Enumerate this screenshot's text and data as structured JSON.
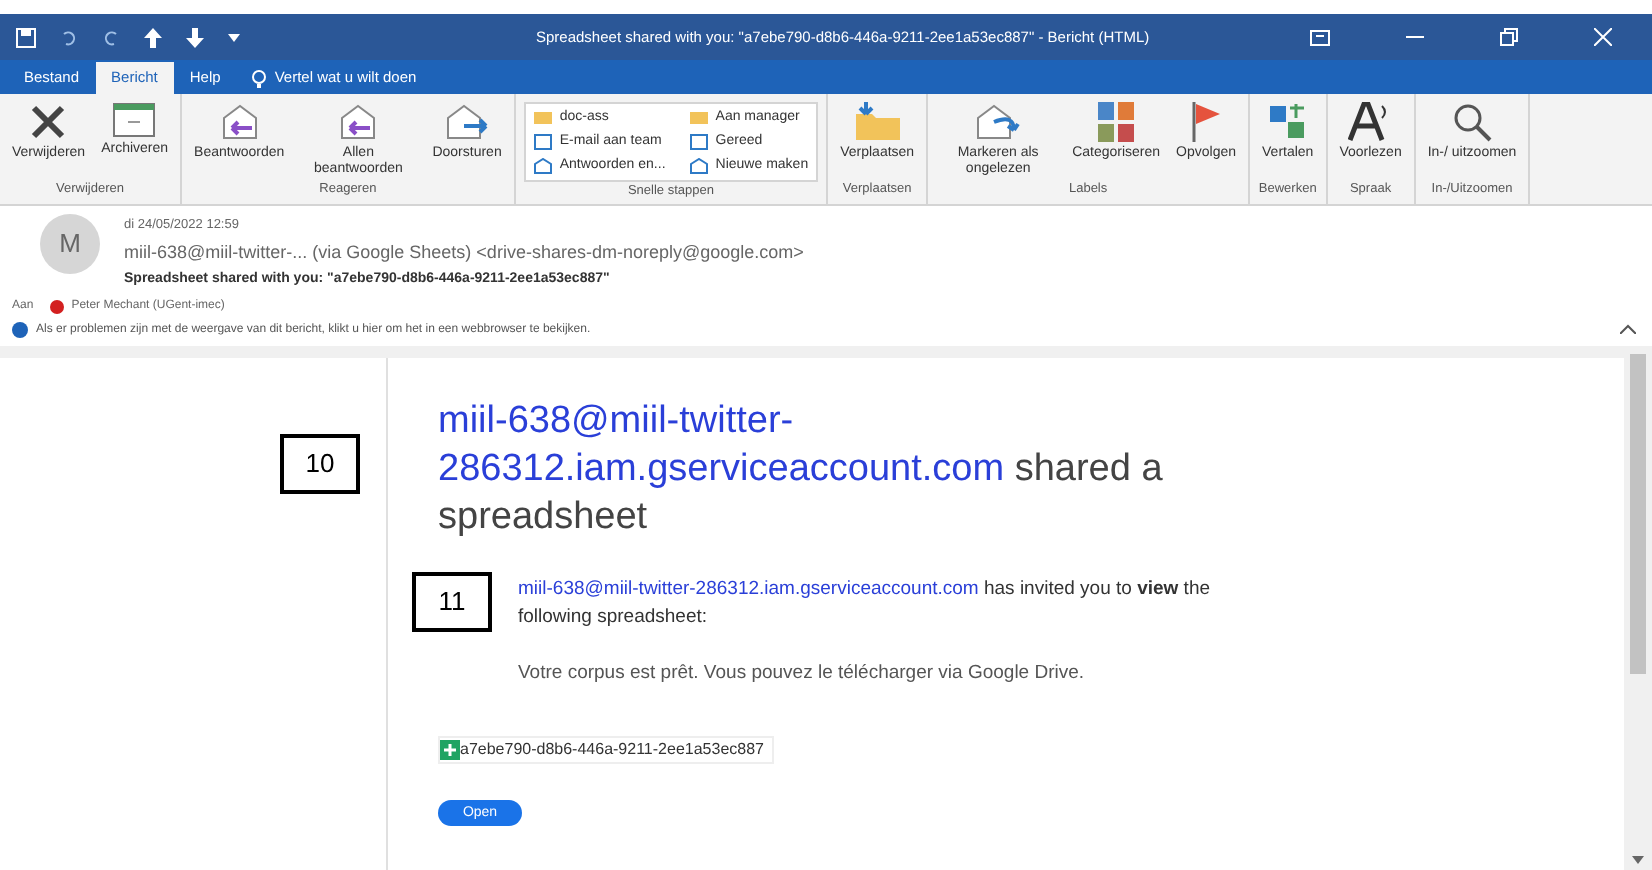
{
  "window": {
    "title": "Spreadsheet shared with you: \"a7ebe790-d8b6-446a-9211-2ee1a53ec887\"  -  Bericht (HTML)"
  },
  "tabs": [
    {
      "label": "Bestand",
      "selected": false
    },
    {
      "label": "Bericht",
      "selected": true
    },
    {
      "label": "Help",
      "selected": false
    }
  ],
  "tell_me": {
    "placeholder": "Vertel wat u wilt doen"
  },
  "ribbon": {
    "groups": [
      {
        "label": "Verwijderen",
        "buttons": [
          {
            "label": "Verwijderen"
          },
          {
            "label": "Archiveren"
          }
        ]
      },
      {
        "label": "Reageren",
        "buttons": [
          {
            "label": "Beantwoorden"
          },
          {
            "label": "Allen beantwoorden"
          },
          {
            "label": "Doorsturen"
          }
        ]
      },
      {
        "label": "Snelle stappen",
        "quick_steps": [
          "doc-ass",
          "E-mail aan team",
          "Antwoorden en...",
          "Aan manager",
          "Gereed",
          "Nieuwe maken"
        ]
      },
      {
        "label": "Verplaatsen",
        "buttons": [
          {
            "label": "Verplaatsen"
          }
        ]
      },
      {
        "label": "Labels",
        "buttons": [
          {
            "label": "Markeren als ongelezen"
          },
          {
            "label": "Categoriseren"
          },
          {
            "label": "Opvolgen"
          }
        ]
      },
      {
        "label": "Bewerken",
        "buttons": [
          {
            "label": "Vertalen"
          }
        ]
      },
      {
        "label": "Spraak",
        "buttons": [
          {
            "label": "Voorlezen"
          }
        ]
      },
      {
        "label": "In-/Uitzoomen",
        "buttons": [
          {
            "label": "In-/ uitzoomen"
          }
        ]
      }
    ]
  },
  "message": {
    "avatar": "M",
    "date": "di 24/05/2022 12:59",
    "from": "miil-638@miil-twitter-... (via Google Sheets) <drive-shares-dm-noreply@google.com>",
    "subject": "Spreadsheet shared with you: \"a7ebe790-d8b6-446a-9211-2ee1a53ec887\"",
    "to_label": "Aan",
    "to": "Peter Mechant (UGent-imec)",
    "info": "Als er problemen zijn met de weergave van dit bericht, klikt u hier om het in een webbrowser te bekijken."
  },
  "body": {
    "marker_1": "10",
    "heading_link": "miil-638@miil-twitter-286312.iam.gserviceaccount.com",
    "heading_rest": " shared a spreadsheet",
    "marker_2": "11",
    "invite_link": "miil-638@miil-twitter-286312.iam.gserviceaccount.com",
    "invite": " has invited you to **view** the following spreadsheet:",
    "note": "Votre corpus est prêt. Vous pouvez le télécharger via Google Drive.",
    "file": "a7ebe790-d8b6-446a-9211-2ee1a53ec887",
    "button": "Open"
  }
}
